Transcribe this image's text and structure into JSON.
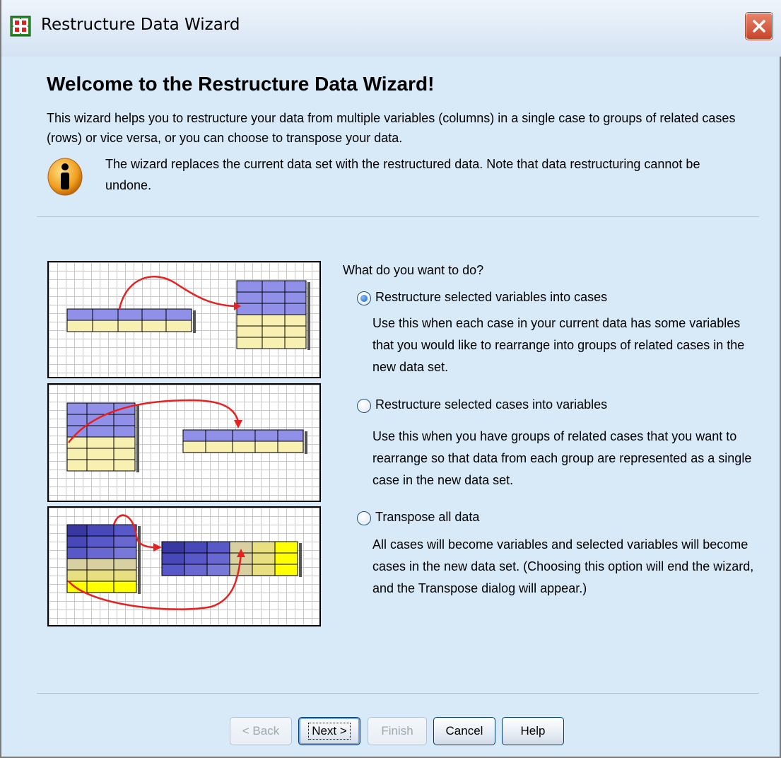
{
  "window": {
    "title": "Restructure Data Wizard"
  },
  "header": {
    "heading": "Welcome to the Restructure Data Wizard!",
    "intro": "This wizard helps you to restructure your data from multiple variables (columns) in a single case to groups of related cases (rows) or vice versa, or you can choose to transpose your data.",
    "note": "The wizard replaces the current data set with the restructured data.  Note that data restructuring cannot be undone."
  },
  "options": {
    "question": "What do you want to do?",
    "items": [
      {
        "label": "Restructure selected variables into cases",
        "selected": true,
        "description": "Use this when each case in your current data has some variables that you would like to rearrange into groups of related cases in the new data set."
      },
      {
        "label": "Restructure selected cases into variables",
        "selected": false,
        "description": "Use this when you have groups of related cases that you want to rearrange so that data from each group are represented as a single case in the new data set."
      },
      {
        "label": "Transpose all data",
        "selected": false,
        "description": "All cases will become variables and selected variables will become cases in the new data set. (Choosing this option will end the wizard, and the Transpose dialog will appear.)"
      }
    ]
  },
  "buttons": {
    "back": "< Back",
    "next": "Next >",
    "finish": "Finish",
    "cancel": "Cancel",
    "help": "Help"
  },
  "colors": {
    "background": "#d8e9f8",
    "radio_selected": "#1a5fbf",
    "arrow": "#e82020",
    "var_header": "#9090e8",
    "case_row": "#f8f0b0",
    "transpose_dark": "#3838a0",
    "transpose_yellow": "#ffff00"
  },
  "icons": [
    "spss-data-icon",
    "close-icon",
    "info-icon",
    "restructure-vars-to-cases-diagram",
    "restructure-cases-to-vars-diagram",
    "transpose-diagram"
  ]
}
